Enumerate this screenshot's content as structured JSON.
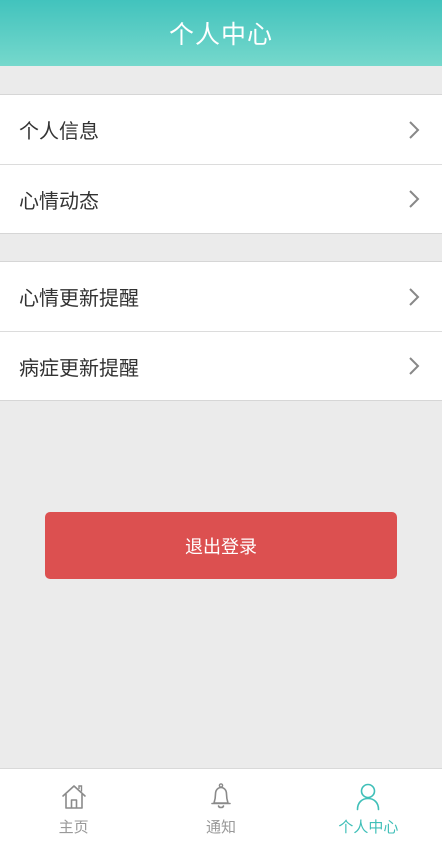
{
  "header": {
    "title": "个人中心"
  },
  "menu": {
    "group1": [
      {
        "label": "个人信息",
        "icon": "chevron-right-icon"
      },
      {
        "label": "心情动态",
        "icon": "chevron-right-icon"
      }
    ],
    "group2": [
      {
        "label": "心情更新提醒",
        "icon": "chevron-right-icon"
      },
      {
        "label": "病症更新提醒",
        "icon": "chevron-right-icon"
      }
    ]
  },
  "logout": {
    "label": "退出登录"
  },
  "tabbar": {
    "tabs": [
      {
        "label": "主页",
        "icon": "home-icon",
        "active": false
      },
      {
        "label": "通知",
        "icon": "bell-icon",
        "active": false
      },
      {
        "label": "个人中心",
        "icon": "user-icon",
        "active": true
      }
    ]
  },
  "colors": {
    "header_gradient_top": "#42c3bd",
    "header_gradient_bottom": "#76d8cc",
    "logout": "#dc5050",
    "active_tab": "#3fbfb8",
    "inactive_tab": "#999999",
    "background": "#ebebeb"
  }
}
